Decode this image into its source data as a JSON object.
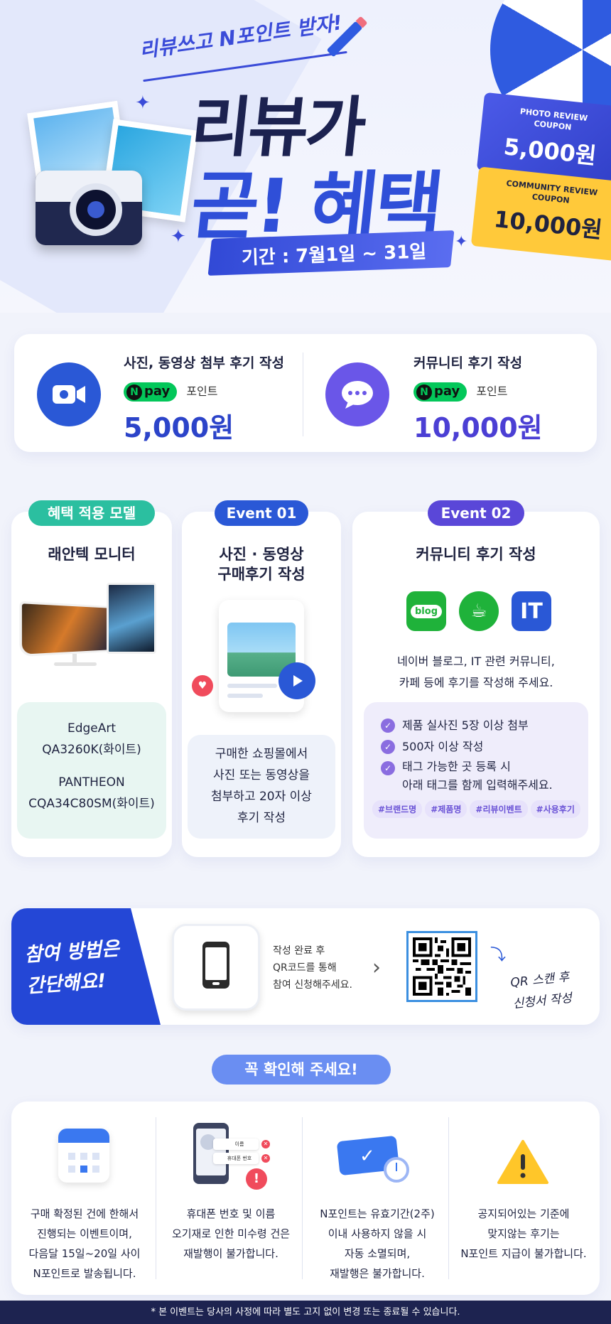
{
  "hero": {
    "tagline": "리뷰쓰고 N포인트 받자!",
    "title_line1": "리뷰가",
    "title_line2": "곧! 혜택",
    "period": "기간 : 7월1일 ~ 31일",
    "coupon1": {
      "label_line1": "PHOTO REVIEW",
      "label_line2": "COUPON",
      "value": "5,000원"
    },
    "coupon2": {
      "label_line1": "COMMUNITY REVIEW",
      "label_line2": "COUPON",
      "value": "10,000원"
    }
  },
  "rewards": [
    {
      "title": "사진, 동영상 첨부 후기 작성",
      "pay": "pay",
      "point_label": "포인트",
      "amount": "5,000원",
      "icon": "video-camera-icon",
      "color": "#2a58d6"
    },
    {
      "title": "커뮤니티 후기 작성",
      "pay": "pay",
      "point_label": "포인트",
      "amount": "10,000원",
      "icon": "chat-bubble-icon",
      "color": "#6a56e8"
    }
  ],
  "columns": {
    "models": {
      "pill": "혜택 적용 모델",
      "title": "래안텍 모니터",
      "model1_line1": "EdgeArt",
      "model1_line2": "QA3260K(화이트)",
      "model2_line1": "PANTHEON",
      "model2_line2": "CQA34C80SM(화이트)"
    },
    "event1": {
      "pill": "Event 01",
      "title_line1": "사진 · 동영상",
      "title_line2": "구매후기 작성",
      "desc_line1": "구매한 쇼핑몰에서",
      "desc_line2": "사진 또는 동영상을",
      "desc_line3": "첨부하고 20자 이상",
      "desc_line4": "후기 작성"
    },
    "event2": {
      "pill": "Event 02",
      "title": "커뮤니티 후기 작성",
      "apps": [
        "blog",
        "IT"
      ],
      "desc_line1": "네이버 블로그, IT 관련 커뮤니티,",
      "desc_line2": "카페 등에 후기를 작성해 주세요.",
      "checks": [
        "제품 실사진 5장 이상 첨부",
        "500자 이상 작성",
        "태그 가능한 곳 등록 시",
        "아래 태그를 함께 입력해주세요."
      ],
      "tags": [
        "#브랜드명",
        "#제품명",
        "#리뷰이벤트",
        "#사용후기"
      ]
    }
  },
  "how": {
    "headline_line1": "참여 방법은",
    "headline_line2": "간단해요!",
    "desc_line1": "작성 완료 후",
    "desc_line2": "QR코드를 통해",
    "desc_line3": "참여 신청해주세요.",
    "note_line1": "QR 스캔 후",
    "note_line2": "신청서 작성"
  },
  "notice": {
    "pill": "꼭 확인해 주세요!",
    "items": [
      {
        "icon": "calendar-icon",
        "lines": [
          "구매 확정된 건에 한해서",
          "진행되는 이벤트이며,",
          "다음달 15일~20일 사이",
          "N포인트로 발송됩니다."
        ]
      },
      {
        "icon": "phone-form-icon",
        "lines": [
          "휴대폰 번호 및 이름",
          "오기재로 인한 미수령 건은",
          "재발행이 불가합니다."
        ],
        "form_name": "이름",
        "form_phone": "휴대폰 번호"
      },
      {
        "icon": "ticket-clock-icon",
        "lines": [
          "N포인트는 유효기간(2주)",
          "이내 사용하지 않을 시",
          "자동 소멸되며,",
          "재발행은 불가합니다."
        ]
      },
      {
        "icon": "warning-icon",
        "lines": [
          "공지되어있는 기준에",
          "맞지않는 후기는",
          "N포인트 지급이 불가합니다."
        ]
      }
    ]
  },
  "footer": "* 본 이벤트는 당사의 사정에 따라 별도 고지 없이 변경 또는 종료될 수 있습니다."
}
